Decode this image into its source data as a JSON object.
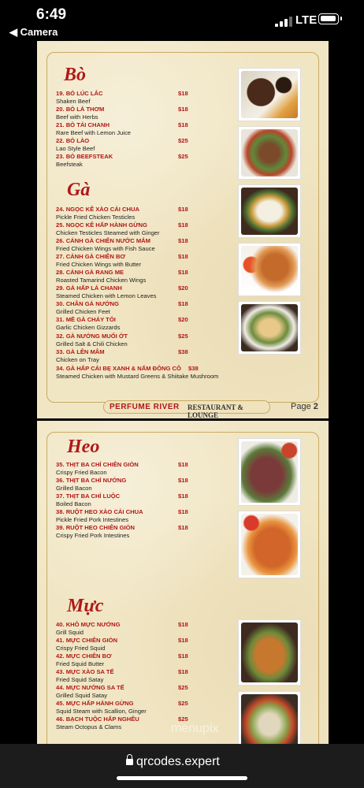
{
  "status_bar": {
    "time": "6:49",
    "back_label": "◀ Camera",
    "network": "LTE"
  },
  "page1": {
    "sections": [
      {
        "title": "Bò",
        "items": [
          {
            "num": "19.",
            "vn": "BÒ LÚC LẮC",
            "en": "Shaken Beef",
            "price": "$18"
          },
          {
            "num": "20.",
            "vn": "BÒ LÁ THƠM",
            "en": "Beef with Herbs",
            "price": "$18"
          },
          {
            "num": "21.",
            "vn": "BÒ TÁI CHANH",
            "en": "Rare Beef with Lemon Juice",
            "price": "$18"
          },
          {
            "num": "22.",
            "vn": "BÒ LÀO",
            "en": "Lao Style Beef",
            "price": "$25"
          },
          {
            "num": "23.",
            "vn": "BÒ BEEFSTEAK",
            "en": "Beefsteak",
            "price": "$25"
          }
        ]
      },
      {
        "title": "Gà",
        "items": [
          {
            "num": "24.",
            "vn": "NGỌC KÊ XÀO CẢI CHUA",
            "en": "Pickle Fried Chicken Testicles",
            "price": "$18"
          },
          {
            "num": "25.",
            "vn": "NGỌC KÊ HẤP HÀNH GỪNG",
            "en": "Chicken Testicles Steamed with Ginger",
            "price": "$18"
          },
          {
            "num": "26.",
            "vn": "CÁNH GÀ CHIÊN NƯỚC MẮM",
            "en": "Fried Chicken Wings with Fish Sauce",
            "price": "$18"
          },
          {
            "num": "27.",
            "vn": "CÁNH GÀ CHIÊN BƠ",
            "en": "Fried Chicken Wings with Butter",
            "price": "$18"
          },
          {
            "num": "28.",
            "vn": "CÁNH GÀ RANG ME",
            "en": "Roasted Tamarind Chicken Wings",
            "price": "$18"
          },
          {
            "num": "29.",
            "vn": "GÀ HẤP LÁ CHANH",
            "en": "Steamed Chicken with Lemon Leaves",
            "price": "$20"
          },
          {
            "num": "30.",
            "vn": "CHÂN GÀ NƯỚNG",
            "en": "Grilled Chicken Feet",
            "price": "$18"
          },
          {
            "num": "31.",
            "vn": "MỀ GÀ CHÁY TỎI",
            "en": "Garlic Chicken Gizzards",
            "price": "$20"
          },
          {
            "num": "32.",
            "vn": "GÀ NƯỚNG MUỐI ỚT",
            "en": "Grilled Salt & Chili Chicken",
            "price": "$25"
          },
          {
            "num": "33.",
            "vn": "GÀ LÊN MÂM",
            "en": "Chicken on Tray",
            "price": "$38"
          },
          {
            "num": "34.",
            "vn": "GÀ HẤP CẢI BẸ XANH & NẤM ĐÔNG CÔ",
            "en": "Steamed Chicken with Mustard Greens & Shiitake Mushroom",
            "price": "$38"
          }
        ]
      }
    ],
    "footer_brand": "PERFUME RIVER",
    "footer_sub": "RESTAURANT & LOUNGE",
    "page_label": "Page",
    "page_number": "2"
  },
  "page2": {
    "sections": [
      {
        "title": "Heo",
        "items": [
          {
            "num": "35.",
            "vn": "THỊT BA CHỈ CHIÊN GIÒN",
            "en": "Crispy Fried Bacon",
            "price": "$18"
          },
          {
            "num": "36.",
            "vn": "THỊT BA CHỈ NƯỚNG",
            "en": "Grilled Bacon",
            "price": "$18"
          },
          {
            "num": "37.",
            "vn": "THỊT BA CHỈ LUỘC",
            "en": "Boiled Bacon",
            "price": "$18"
          },
          {
            "num": "38.",
            "vn": "RUỘT HEO XÀO CẢI CHUA",
            "en": "Pickle Fried Pork Intestines",
            "price": "$18"
          },
          {
            "num": "39.",
            "vn": "RUỘT HEO CHIÊN GIÒN",
            "en": "Crispy Fried  Pork Intestines",
            "price": "$18"
          }
        ]
      },
      {
        "title": "Mực",
        "items": [
          {
            "num": "40.",
            "vn": "KHÔ MỰC NƯỚNG",
            "en": "Grill Squid",
            "price": "$18"
          },
          {
            "num": "41.",
            "vn": "MỰC CHIÊN GIÒN",
            "en": "Crispy Fried Squid",
            "price": "$18"
          },
          {
            "num": "42.",
            "vn": "MỰC CHIÊN BƠ",
            "en": "Fried Squid Butter",
            "price": "$18"
          },
          {
            "num": "43.",
            "vn": "MỰC XÀO SA TẾ",
            "en": "Fried Squid Satay",
            "price": "$18"
          },
          {
            "num": "44.",
            "vn": "MỰC NƯỚNG SA TẾ",
            "en": "Grilled Squid Satay",
            "price": "$25"
          },
          {
            "num": "45.",
            "vn": "MỰC HẤP HÀNH GỪNG",
            "en": "Squid Steam with Scallion, Ginger",
            "price": "$25"
          },
          {
            "num": "46.",
            "vn": "BẠCH TUỘC HẤP NGHÊU",
            "en": "Steam Octopus & Clams",
            "price": "$25"
          }
        ]
      }
    ]
  },
  "watermark": "menupix",
  "browser": {
    "url": "qrcodes.expert"
  },
  "colors": {
    "accent": "#b01818",
    "paper": "#f1e6c4",
    "border": "#c9aa63"
  }
}
